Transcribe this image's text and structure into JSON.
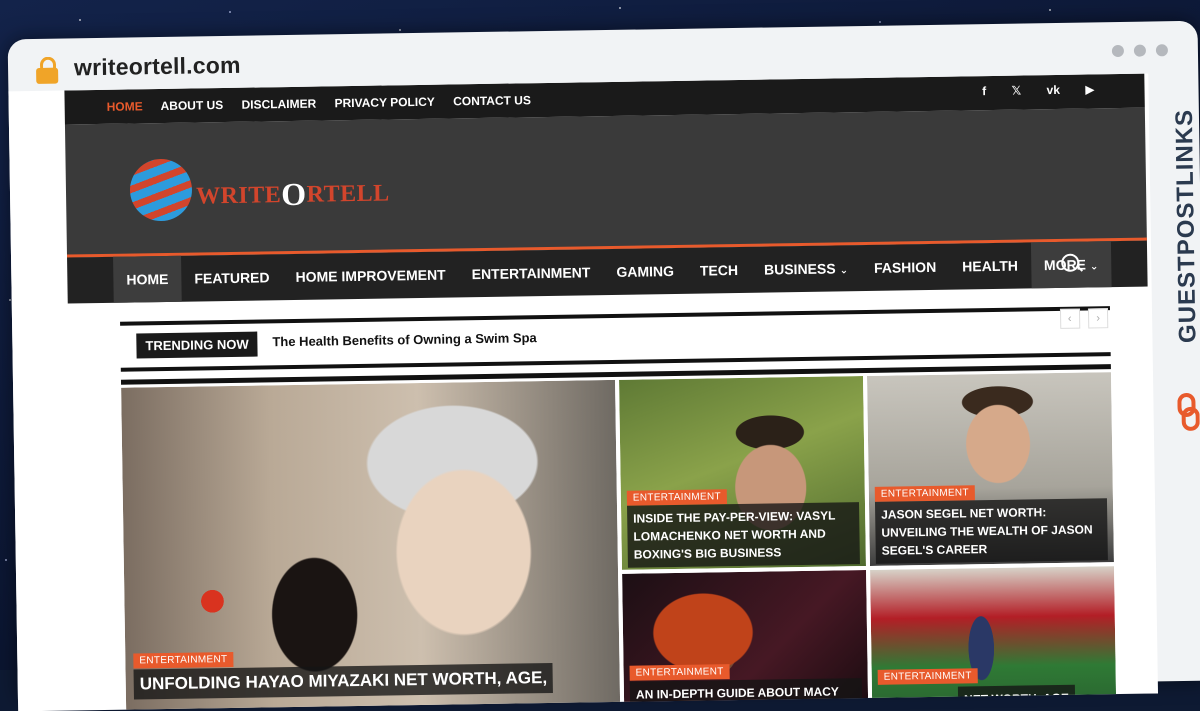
{
  "browser": {
    "url": "writeortell.com"
  },
  "side_brand": {
    "text": "GUESTPOSTLINKS"
  },
  "topbar": {
    "links": [
      "HOME",
      "ABOUT US",
      "DISCLAIMER",
      "PRIVACY POLICY",
      "CONTACT US"
    ],
    "social": [
      "f",
      "𝕏",
      "vk",
      "▶"
    ]
  },
  "logo": {
    "text_left": "WRITE",
    "text_mid": "O",
    "text_right": "RTELL"
  },
  "nav": {
    "items": [
      "HOME",
      "FEATURED",
      "HOME IMPROVEMENT",
      "ENTERTAINMENT",
      "GAMING",
      "TECH",
      "BUSINESS",
      "FASHION",
      "HEALTH",
      "MORE"
    ]
  },
  "trending": {
    "label": "TRENDING NOW",
    "headline": "The Health Benefits of Owning a Swim Spa",
    "prev": "‹",
    "next": "›"
  },
  "tiles": {
    "main": {
      "category": "ENTERTAINMENT",
      "title": "UNFOLDING HAYAO MIYAZAKI NET WORTH, AGE,"
    },
    "a": {
      "category": "ENTERTAINMENT",
      "title": "INSIDE THE PAY-PER-VIEW: VASYL LOMACHENKO NET WORTH AND BOXING'S BIG BUSINESS"
    },
    "b": {
      "category": "ENTERTAINMENT",
      "title": "JASON SEGEL NET WORTH: UNVEILING THE WEALTH OF JASON SEGEL'S CAREER"
    },
    "c": {
      "category": "ENTERTAINMENT",
      "title": "AN IN-DEPTH GUIDE ABOUT MACY"
    },
    "d": {
      "category": "ENTERTAINMENT",
      "title": "NET WORTH, AGE"
    }
  },
  "colors": {
    "accent": "#e85a2c",
    "dark": "#1a1a1a"
  }
}
